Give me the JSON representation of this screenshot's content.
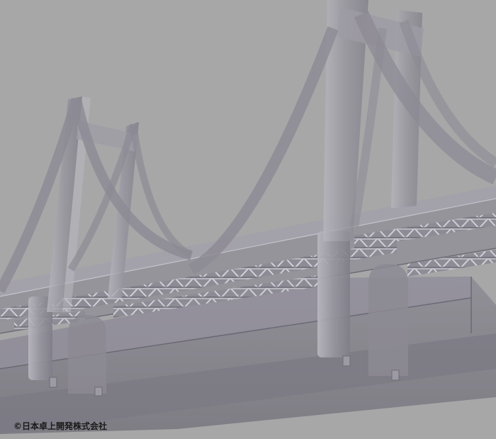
{
  "image": {
    "subject": "bridge-render",
    "background_color": "#a7a7a8"
  },
  "copyright": {
    "text": "©日本卓上開発株式会社"
  },
  "colors": {
    "structure_fill": "#8f8d96",
    "structure_highlight": "#c0bec6",
    "structure_shadow": "#6f6d78",
    "deck_top": "#9b99a2",
    "slab_dark": "#7d7b84"
  }
}
